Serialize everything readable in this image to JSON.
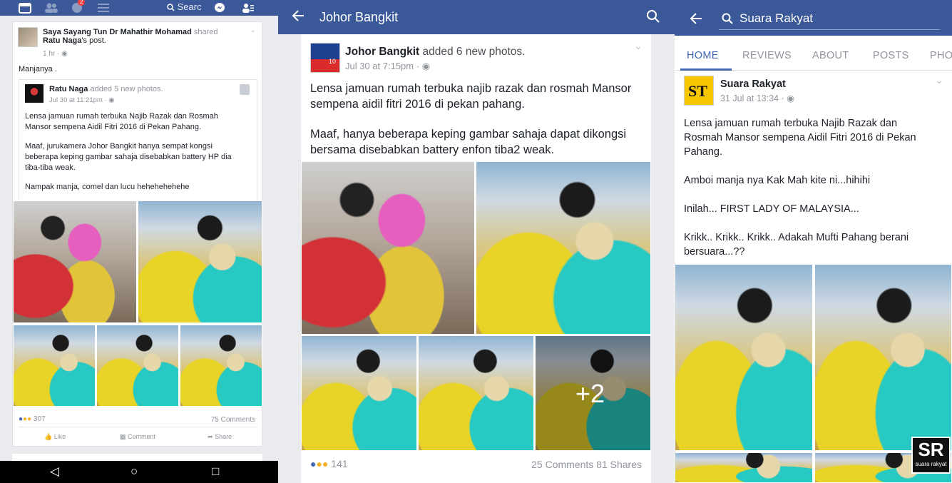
{
  "panel1": {
    "nav": {
      "search_label": "Searc",
      "notification_count": "2"
    },
    "post": {
      "sharer": "Saya Sayang Tun Dr Mahathir Mohamad",
      "action": " shared",
      "original_author": "Ratu Naga",
      "original_suffix": "'s post.",
      "time": "1 hr ·",
      "caption": "Manjanya ."
    },
    "shared": {
      "author": "Ratu Naga",
      "action": " added 5 new photos.",
      "time": "Jul 30 at 11:21pm ·",
      "line1": "Lensa jamuan rumah terbuka Najib Razak dan Rosmah",
      "line2": "Mansor sempena Aidil Fitri 2016 di Pekan Pahang.",
      "line3": "Maaf, jurukamera Johor Bangkit hanya sempat kongsi",
      "line4": "beberapa keping gambar sahaja disebabkan battery HP dia",
      "line5": "tiba-tiba weak.",
      "line6": "Nampak manja, comel dan lucu hehehehehehe"
    },
    "stats": {
      "reactions": "307",
      "comments": "75 Comments"
    },
    "actions": {
      "like": "Like",
      "comment": "Comment",
      "share": "Share"
    }
  },
  "panel2": {
    "title": "Johor Bangkit",
    "post": {
      "author": "Johor Bangkit",
      "action": " added 6 new photos.",
      "time": "Jul 30 at 7:15pm ·",
      "avatar_text": "10",
      "line1": "Lensa jamuan rumah terbuka najib razak dan rosmah Mansor",
      "line2": "sempena aidil fitri 2016 di pekan pahang.",
      "line3": "Maaf, hanya beberapa keping gambar sahaja dapat dikongsi",
      "line4": "bersama disebabkan battery enfon tiba2 weak.",
      "more_photos": "+2"
    },
    "stats": {
      "reactions": "141",
      "comments_shares": "25 Comments 81 Shares"
    }
  },
  "panel3": {
    "search_value": "Suara Rakyat",
    "tabs": [
      "HOME",
      "REVIEWS",
      "ABOUT",
      "POSTS",
      "PHO"
    ],
    "post": {
      "author": "Suara Rakyat",
      "time": "31 Jul at 13:34 ·",
      "avatar_text": "ST",
      "line1": "Lensa jamuan rumah terbuka Najib Razak dan",
      "line2": "Rosmah Mansor sempena Aidil Fitri 2016 di Pekan",
      "line3": "Pahang.",
      "line4": "Amboi manja nya Kak Mah kite ni...hihihi",
      "line5": "Inilah... FIRST LADY OF MALAYSIA...",
      "line6": "Krikk.. Krikk.. Krikk.. Adakah Mufti Pahang berani",
      "line7": "bersuara...??"
    },
    "watermark": {
      "big": "SR",
      "small": "suara rakyat"
    }
  },
  "colors": {
    "facebook_blue": "#3b5998",
    "link_blue": "#365899",
    "tab_active": "#4267b2"
  }
}
